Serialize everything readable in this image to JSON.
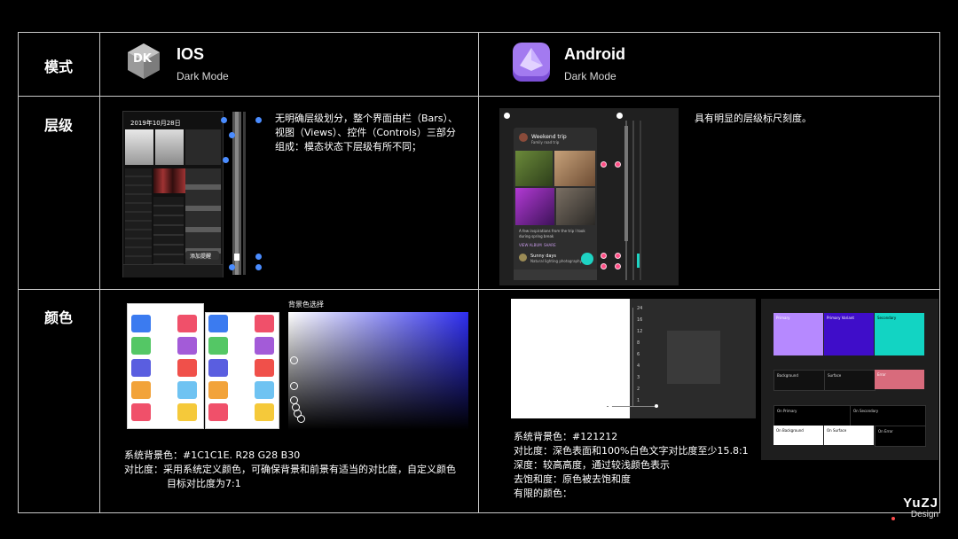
{
  "table": {
    "row_labels": {
      "mode": "模式",
      "levels": "层级",
      "color": "颜色"
    }
  },
  "ios": {
    "title": "IOS",
    "subtitle": "Dark Mode",
    "logo_text": "DK",
    "levels_desc": [
      "无明确层级划分，整个界面由栏（Bars）、",
      "视图（Views）、控件（Controls）三部分",
      "组成：模态状态下层级有所不同；"
    ],
    "mock_date": "2019年10月28日",
    "mock_button": "添加提醒",
    "picker_title": "背景色选择",
    "color_desc": [
      "系统背景色：#1C1C1E.   R28 G28 B30",
      "对比度：采用系统定义颜色，可确保背景和前景有适当的对比度，自定义颜色",
      "目标对比度为7:1"
    ],
    "swatch_colors": [
      "#3b7bf0",
      "#f0506a",
      "#54c765",
      "#a35bd8",
      "#5a5ee0",
      "#f0504a",
      "#f2a33a",
      "#6fc3f2",
      "#f0506a",
      "#f5c93a"
    ]
  },
  "android": {
    "title": "Android",
    "subtitle": "Dark Mode",
    "levels_desc": "具有明显的层级标尺刻度。",
    "card1_title": "Weekend trip",
    "card1_sub": "Family road trip",
    "card2_text": "A few inspirations from the trip I took during spring break",
    "card_actions": [
      "VIEW ALBUM",
      "SHARE"
    ],
    "card3_title": "Sunny days",
    "card3_sub": "Natural lighting photography",
    "ruler_ticks": [
      "24",
      "16",
      "12",
      "8",
      "6",
      "4",
      "3",
      "2",
      "1"
    ],
    "palette": {
      "primary": "Primary",
      "primary_variant": "Primary Variant",
      "secondary": "Secondary",
      "background": "Background",
      "surface": "Surface",
      "error": "Error",
      "on_primary": "On Primary",
      "on_secondary": "On Secondary",
      "on_background": "On Background",
      "on_surface": "On Surface",
      "on_error": "On Error"
    },
    "color_desc": [
      "系统背景色：#121212",
      "对比度：深色表面和100%白色文字对比度至少15.8:1",
      "深度：较高高度，通过较浅颜色表示",
      "去饱和度：原色被去饱和度",
      "有限的颜色："
    ]
  },
  "watermark": {
    "brand": "YuZJ",
    "sub": "Design"
  },
  "colors": {
    "grid_line": "#c9c9c9",
    "accent_blue": "#4a8cff",
    "accent_pink": "#ff4f86"
  }
}
